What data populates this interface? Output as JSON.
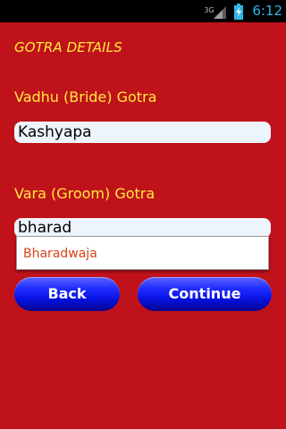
{
  "status_bar": {
    "network": "3G",
    "time": "6:12",
    "icons": [
      "signal-icon",
      "battery-charging-icon"
    ]
  },
  "form": {
    "heading": "GOTRA DETAILS",
    "bride_label": "Vadhu (Bride) Gotra",
    "bride_value": "Kashyapa",
    "groom_label": "Vara (Groom) Gotra",
    "groom_value": "bharad",
    "suggestions": [
      "Bharadwaja"
    ]
  },
  "buttons": {
    "back": "Back",
    "continue": "Continue"
  },
  "colors": {
    "background": "#c0121a",
    "label_text": "#ffeb3b",
    "time_text": "#33b5e5",
    "suggestion_text": "#d84315",
    "button_blue": "#1e2bff"
  }
}
